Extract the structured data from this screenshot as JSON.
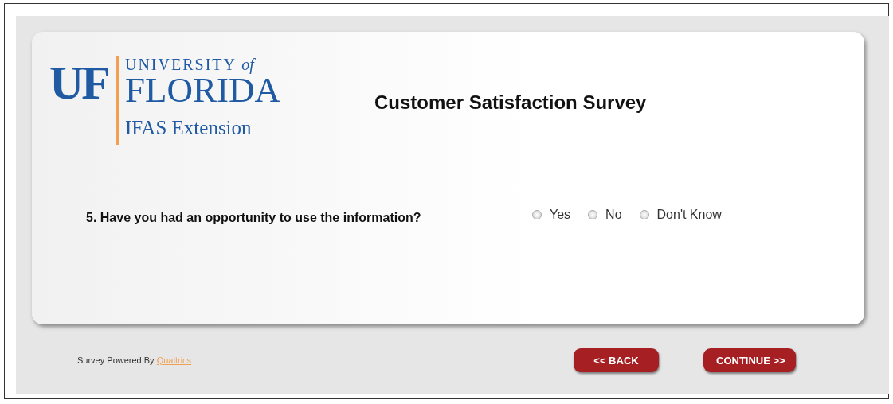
{
  "logo": {
    "mark": "UF",
    "line1": "UNIVERSITY",
    "line1_suffix": "of",
    "line2": "FLORIDA",
    "line3": "IFAS Extension"
  },
  "title": "Customer Satisfaction Survey",
  "question": {
    "text": "5. Have you had an opportunity to use the information?",
    "options": [
      {
        "label": "Yes",
        "selected": false
      },
      {
        "label": "No",
        "selected": false
      },
      {
        "label": "Don't Know",
        "selected": false
      }
    ]
  },
  "footer": {
    "powered_by": "Survey Powered By",
    "link": "Qualtrics"
  },
  "buttons": [
    {
      "label": "<< BACK"
    },
    {
      "label": "CONTINUE >>"
    }
  ]
}
